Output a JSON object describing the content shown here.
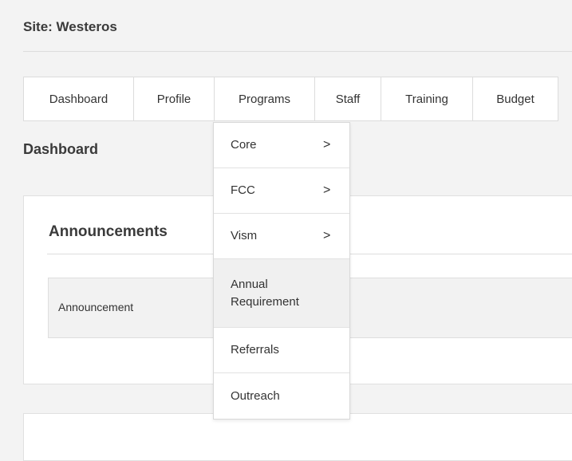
{
  "site": {
    "title": "Site: Westeros"
  },
  "tabs": [
    {
      "label": "Dashboard"
    },
    {
      "label": "Profile"
    },
    {
      "label": "Programs"
    },
    {
      "label": "Staff"
    },
    {
      "label": "Training"
    },
    {
      "label": "Budget"
    }
  ],
  "page": {
    "title": "Dashboard"
  },
  "announcements": {
    "title": "Announcements",
    "column_header": "Announcement"
  },
  "programs_menu": {
    "items": [
      {
        "label": "Core",
        "submenu_icon": ">"
      },
      {
        "label": "FCC",
        "submenu_icon": ">"
      },
      {
        "label": "Vism",
        "submenu_icon": ">"
      },
      {
        "label": "Annual Requirement"
      },
      {
        "label": "Referrals"
      },
      {
        "label": "Outreach"
      }
    ]
  }
}
